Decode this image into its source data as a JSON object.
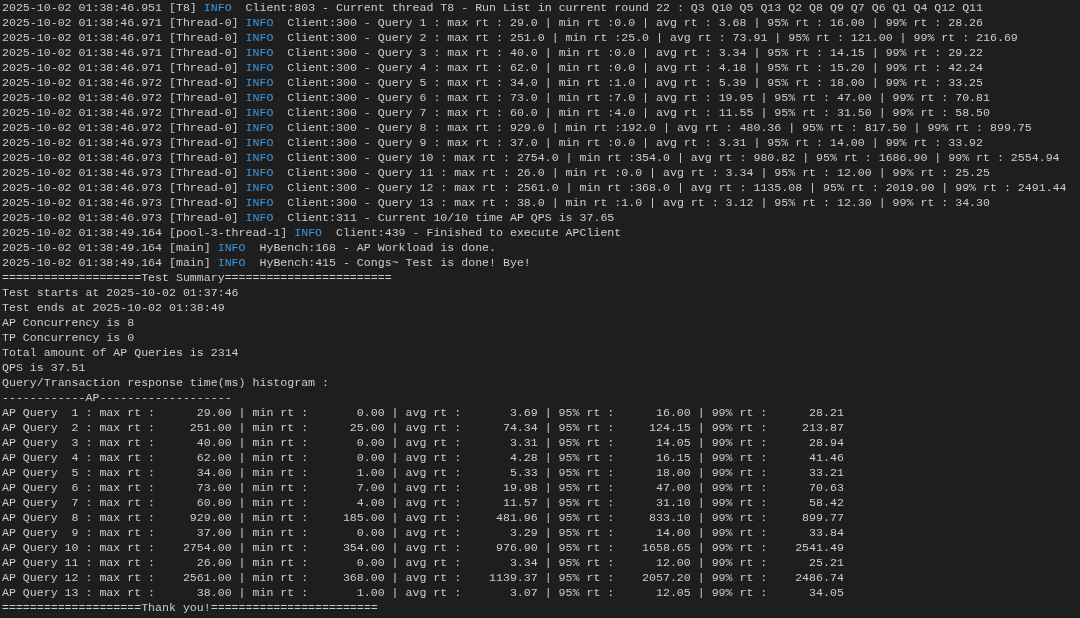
{
  "log_lines": [
    {
      "prefix": "2025-10-02 01:38:46.951 [T8]",
      "level": "INFO",
      "message": "Client:803 - Current thread T8 - Run List in current round 22 : Q3 Q10 Q5 Q13 Q2 Q8 Q9 Q7 Q6 Q1 Q4 Q12 Q11"
    },
    {
      "prefix": "2025-10-02 01:38:46.971 [Thread-0]",
      "level": "INFO",
      "message": "Client:300 - Query 1 : max rt : 29.0 | min rt :0.0 | avg rt : 3.68 | 95% rt : 16.00 | 99% rt : 28.26"
    },
    {
      "prefix": "2025-10-02 01:38:46.971 [Thread-0]",
      "level": "INFO",
      "message": "Client:300 - Query 2 : max rt : 251.0 | min rt :25.0 | avg rt : 73.91 | 95% rt : 121.00 | 99% rt : 216.69"
    },
    {
      "prefix": "2025-10-02 01:38:46.971 [Thread-0]",
      "level": "INFO",
      "message": "Client:300 - Query 3 : max rt : 40.0 | min rt :0.0 | avg rt : 3.34 | 95% rt : 14.15 | 99% rt : 29.22"
    },
    {
      "prefix": "2025-10-02 01:38:46.971 [Thread-0]",
      "level": "INFO",
      "message": "Client:300 - Query 4 : max rt : 62.0 | min rt :0.0 | avg rt : 4.18 | 95% rt : 15.20 | 99% rt : 42.24"
    },
    {
      "prefix": "2025-10-02 01:38:46.972 [Thread-0]",
      "level": "INFO",
      "message": "Client:300 - Query 5 : max rt : 34.0 | min rt :1.0 | avg rt : 5.39 | 95% rt : 18.00 | 99% rt : 33.25"
    },
    {
      "prefix": "2025-10-02 01:38:46.972 [Thread-0]",
      "level": "INFO",
      "message": "Client:300 - Query 6 : max rt : 73.0 | min rt :7.0 | avg rt : 19.95 | 95% rt : 47.00 | 99% rt : 70.81"
    },
    {
      "prefix": "2025-10-02 01:38:46.972 [Thread-0]",
      "level": "INFO",
      "message": "Client:300 - Query 7 : max rt : 60.0 | min rt :4.0 | avg rt : 11.55 | 95% rt : 31.50 | 99% rt : 58.50"
    },
    {
      "prefix": "2025-10-02 01:38:46.972 [Thread-0]",
      "level": "INFO",
      "message": "Client:300 - Query 8 : max rt : 929.0 | min rt :192.0 | avg rt : 480.36 | 95% rt : 817.50 | 99% rt : 899.75"
    },
    {
      "prefix": "2025-10-02 01:38:46.973 [Thread-0]",
      "level": "INFO",
      "message": "Client:300 - Query 9 : max rt : 37.0 | min rt :0.0 | avg rt : 3.31 | 95% rt : 14.00 | 99% rt : 33.92"
    },
    {
      "prefix": "2025-10-02 01:38:46.973 [Thread-0]",
      "level": "INFO",
      "message": "Client:300 - Query 10 : max rt : 2754.0 | min rt :354.0 | avg rt : 980.82 | 95% rt : 1686.90 | 99% rt : 2554.94"
    },
    {
      "prefix": "2025-10-02 01:38:46.973 [Thread-0]",
      "level": "INFO",
      "message": "Client:300 - Query 11 : max rt : 26.0 | min rt :0.0 | avg rt : 3.34 | 95% rt : 12.00 | 99% rt : 25.25"
    },
    {
      "prefix": "2025-10-02 01:38:46.973 [Thread-0]",
      "level": "INFO",
      "message": "Client:300 - Query 12 : max rt : 2561.0 | min rt :368.0 | avg rt : 1135.08 | 95% rt : 2019.90 | 99% rt : 2491.44"
    },
    {
      "prefix": "2025-10-02 01:38:46.973 [Thread-0]",
      "level": "INFO",
      "message": "Client:300 - Query 13 : max rt : 38.0 | min rt :1.0 | avg rt : 3.12 | 95% rt : 12.30 | 99% rt : 34.30"
    },
    {
      "prefix": "2025-10-02 01:38:46.973 [Thread-0]",
      "level": "INFO",
      "message": "Client:311 - Current 10/10 time AP QPS is 37.65"
    },
    {
      "prefix": "2025-10-02 01:38:49.164 [pool-3-thread-1]",
      "level": "INFO",
      "message": "Client:439 - Finished to execute APClient"
    },
    {
      "prefix": "2025-10-02 01:38:49.164 [main]",
      "level": "INFO",
      "message": "HyBench:168 - AP Workload is done."
    },
    {
      "prefix": "2025-10-02 01:38:49.164 [main]",
      "level": "INFO",
      "message": "HyBench:415 - Congs~ Test is done! Bye!"
    }
  ],
  "summary_header": "====================Test Summary========================",
  "summary_lines": [
    "Test starts at 2025-10-02 01:37:46",
    "Test ends at 2025-10-02 01:38:49",
    "AP Concurrency is 8",
    "TP Concurrency is 0",
    "Total amount of AP Queries is 2314",
    "QPS is 37.51",
    "Query/Transaction response time(ms) histogram :"
  ],
  "histogram_header": "------------AP-------------------",
  "histogram_rows": [
    "AP Query  1 : max rt :      29.00 | min rt :       0.00 | avg rt :       3.69 | 95% rt :      16.00 | 99% rt :      28.21",
    "AP Query  2 : max rt :     251.00 | min rt :      25.00 | avg rt :      74.34 | 95% rt :     124.15 | 99% rt :     213.87",
    "AP Query  3 : max rt :      40.00 | min rt :       0.00 | avg rt :       3.31 | 95% rt :      14.05 | 99% rt :      28.94",
    "AP Query  4 : max rt :      62.00 | min rt :       0.00 | avg rt :       4.28 | 95% rt :      16.15 | 99% rt :      41.46",
    "AP Query  5 : max rt :      34.00 | min rt :       1.00 | avg rt :       5.33 | 95% rt :      18.00 | 99% rt :      33.21",
    "AP Query  6 : max rt :      73.00 | min rt :       7.00 | avg rt :      19.98 | 95% rt :      47.00 | 99% rt :      70.63",
    "AP Query  7 : max rt :      60.00 | min rt :       4.00 | avg rt :      11.57 | 95% rt :      31.10 | 99% rt :      58.42",
    "AP Query  8 : max rt :     929.00 | min rt :     185.00 | avg rt :     481.96 | 95% rt :     833.10 | 99% rt :     899.77",
    "AP Query  9 : max rt :      37.00 | min rt :       0.00 | avg rt :       3.29 | 95% rt :      14.00 | 99% rt :      33.84",
    "AP Query 10 : max rt :    2754.00 | min rt :     354.00 | avg rt :     976.90 | 95% rt :    1658.65 | 99% rt :    2541.49",
    "AP Query 11 : max rt :      26.00 | min rt :       0.00 | avg rt :       3.34 | 95% rt :      12.00 | 99% rt :      25.21",
    "AP Query 12 : max rt :    2561.00 | min rt :     368.00 | avg rt :    1139.37 | 95% rt :    2057.20 | 99% rt :    2486.74",
    "AP Query 13 : max rt :      38.00 | min rt :       1.00 | avg rt :       3.07 | 95% rt :      12.05 | 99% rt :      34.05"
  ],
  "footer": "====================Thank you!========================"
}
